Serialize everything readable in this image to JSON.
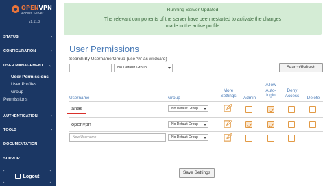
{
  "brand": {
    "name_open": "OPEN",
    "name_vpn": "VPN",
    "subtitle": "Access Server",
    "version": "v2.11.3"
  },
  "nav": {
    "status": "STATUS",
    "configuration": "CONFIGURATION",
    "user_management": "USER MANAGEMENT",
    "sub_items": [
      "User Permissions",
      "User Profiles",
      "Group"
    ],
    "permissions": "Permissions",
    "authentication": "AUTHENTICATION",
    "tools": "TOOLS",
    "documentation": "DOCUMENTATION",
    "support": "SUPPORT",
    "logout": "Logout"
  },
  "banner": {
    "title": "Running Server Updated",
    "message": "The relevant components of the server have been restarted to activate the changes made to the active profile"
  },
  "page": {
    "title": "User Permissions"
  },
  "search": {
    "label": "Search By Username/Group (use '%' as wildcard)",
    "group_filter": "No Default Group",
    "refresh_button": "Search/Refresh"
  },
  "table": {
    "headers": {
      "username": "Username",
      "group": "Group",
      "more_settings": "More Settings",
      "admin": "Admin",
      "allow_auto_login": "Allow Auto-login",
      "deny_access": "Deny Access",
      "delete": "Delete"
    },
    "rows": [
      {
        "username": "anas",
        "group": "No Default Group",
        "admin": false,
        "auto_login": true,
        "deny_access": false,
        "delete": false
      },
      {
        "username": "openvpn",
        "group": "No Default Group",
        "admin": true,
        "auto_login": true,
        "deny_access": false,
        "delete": false
      }
    ],
    "new_row": {
      "placeholder": "New Username",
      "group": "No Default Group"
    }
  },
  "save_button": "Save Settings",
  "colors": {
    "sidebar": "#1b3764",
    "accent": "#4a7bb7",
    "banner_bg": "#d4ecd5",
    "checkbox": "#e29a45",
    "highlight": "#d9302b"
  }
}
